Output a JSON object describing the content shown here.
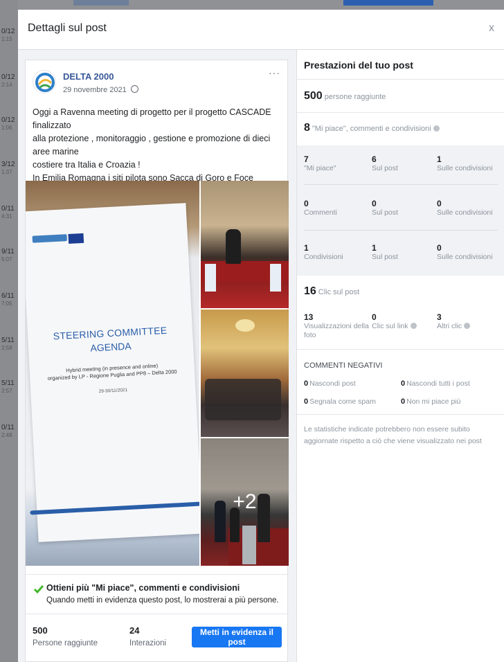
{
  "background": {
    "dates": [
      {
        "d": "0/12",
        "t": "1:15"
      },
      {
        "d": "0/12",
        "t": "2:14"
      },
      {
        "d": "0/12",
        "t": "1:06"
      },
      {
        "d": "3/12",
        "t": "1:37"
      },
      {
        "d": "0/11",
        "t": "4:31"
      },
      {
        "d": "9/11",
        "t": "5:07"
      },
      {
        "d": "6/11",
        "t": "7:05"
      },
      {
        "d": "5/11",
        "t": "2:58"
      },
      {
        "d": "5/11",
        "t": "2:57"
      },
      {
        "d": "0/11",
        "t": "2:48"
      }
    ]
  },
  "modal": {
    "title": "Dettagli sul post",
    "close": "x"
  },
  "post": {
    "page_name": "DELTA 2000",
    "date": "29 novembre 2021",
    "more": "···",
    "text_lines": [
      "Oggi a Ravenna meeting di progetto per il progetto CASCADE finalizzato",
      "alla protezione , monitoraggio , gestione e promozione di dieci aree marine",
      "costiere tra Italia e Croazia !",
      "In Emilia Romagna i siti pilota sono Sacca di Goro e Foce Bevano"
    ],
    "photo_text": {
      "title1": "STEERING COMMITTEE",
      "title2": "AGENDA",
      "sub1": "Hybrid meeting (in presence and online)",
      "sub2": "organized by LP - Regione Puglia and PP8 – Delta 2000",
      "date": "29-30/11/2021"
    },
    "more_photos": "+2",
    "boost_tip": {
      "title": "Ottieni più \"Mi piace\", commenti e condivisioni",
      "text": "Quando metti in evidenza questo post, lo mostrerai a più persone."
    },
    "stats": {
      "reach_value": "500",
      "reach_label": "Persone raggiunte",
      "interactions_value": "24",
      "interactions_label": "Interazioni"
    },
    "boost_button": "Metti in evidenza il post"
  },
  "performance": {
    "title": "Prestazioni del tuo post",
    "reach": {
      "value": "500",
      "label": "persone raggiunte"
    },
    "reactions": {
      "value": "8",
      "label": "\"Mi piace\", commenti e condivisioni"
    },
    "grid": [
      [
        {
          "v": "7",
          "l": "\"Mi piace\""
        },
        {
          "v": "6",
          "l": "Sul post"
        },
        {
          "v": "1",
          "l": "Sulle condivisioni"
        }
      ],
      [
        {
          "v": "0",
          "l": "Commenti"
        },
        {
          "v": "0",
          "l": "Sul post"
        },
        {
          "v": "0",
          "l": "Sulle condivisioni"
        }
      ],
      [
        {
          "v": "1",
          "l": "Condivisioni"
        },
        {
          "v": "1",
          "l": "Sul post"
        },
        {
          "v": "0",
          "l": "Sulle condivisioni"
        }
      ]
    ],
    "clicks": {
      "value": "16",
      "label": "Clic sul post"
    },
    "click_breakdown": [
      {
        "v": "13",
        "l1": "Visualizzazioni della",
        "l2": "foto"
      },
      {
        "v": "0",
        "l1": "Clic sul link",
        "l2": ""
      },
      {
        "v": "3",
        "l1": "Altri clic",
        "l2": ""
      }
    ],
    "negative_title": "COMMENTI NEGATIVI",
    "negative": [
      {
        "v": "0",
        "l": "Nascondi post"
      },
      {
        "v": "0",
        "l": "Nascondi tutti i post"
      },
      {
        "v": "0",
        "l": "Segnala come spam"
      },
      {
        "v": "0",
        "l": "Non mi piace più"
      }
    ],
    "note": "Le statistiche indicate potrebbero non essere subito aggiornate rispetto a ciò che viene visualizzato nei post"
  },
  "colors": {
    "accent": "#1877f2",
    "link": "#385898",
    "check": "#42b72a"
  }
}
